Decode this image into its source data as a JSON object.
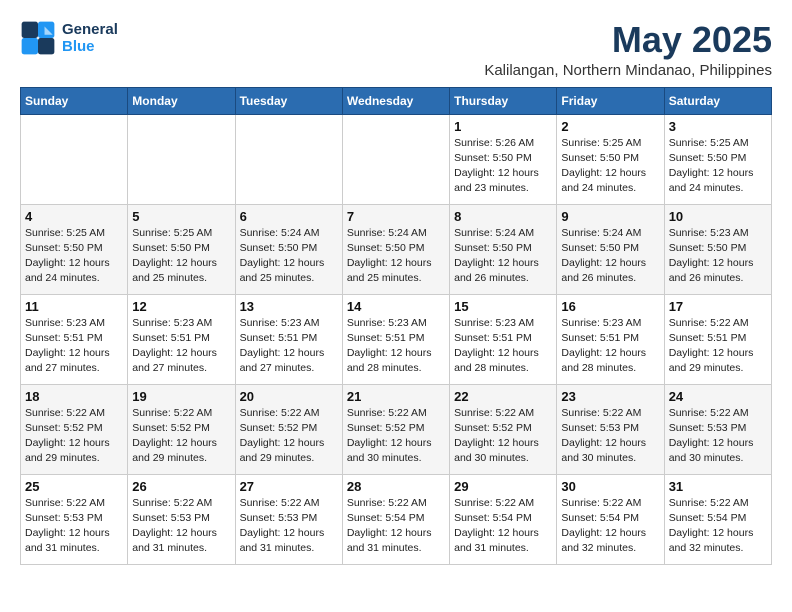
{
  "logo": {
    "text_general": "General",
    "text_blue": "Blue"
  },
  "header": {
    "title": "May 2025",
    "subtitle": "Kalilangan, Northern Mindanao, Philippines"
  },
  "weekdays": [
    "Sunday",
    "Monday",
    "Tuesday",
    "Wednesday",
    "Thursday",
    "Friday",
    "Saturday"
  ],
  "weeks": [
    [
      {
        "day": "",
        "info": ""
      },
      {
        "day": "",
        "info": ""
      },
      {
        "day": "",
        "info": ""
      },
      {
        "day": "",
        "info": ""
      },
      {
        "day": "1",
        "info": "Sunrise: 5:26 AM\nSunset: 5:50 PM\nDaylight: 12 hours\nand 23 minutes."
      },
      {
        "day": "2",
        "info": "Sunrise: 5:25 AM\nSunset: 5:50 PM\nDaylight: 12 hours\nand 24 minutes."
      },
      {
        "day": "3",
        "info": "Sunrise: 5:25 AM\nSunset: 5:50 PM\nDaylight: 12 hours\nand 24 minutes."
      }
    ],
    [
      {
        "day": "4",
        "info": "Sunrise: 5:25 AM\nSunset: 5:50 PM\nDaylight: 12 hours\nand 24 minutes."
      },
      {
        "day": "5",
        "info": "Sunrise: 5:25 AM\nSunset: 5:50 PM\nDaylight: 12 hours\nand 25 minutes."
      },
      {
        "day": "6",
        "info": "Sunrise: 5:24 AM\nSunset: 5:50 PM\nDaylight: 12 hours\nand 25 minutes."
      },
      {
        "day": "7",
        "info": "Sunrise: 5:24 AM\nSunset: 5:50 PM\nDaylight: 12 hours\nand 25 minutes."
      },
      {
        "day": "8",
        "info": "Sunrise: 5:24 AM\nSunset: 5:50 PM\nDaylight: 12 hours\nand 26 minutes."
      },
      {
        "day": "9",
        "info": "Sunrise: 5:24 AM\nSunset: 5:50 PM\nDaylight: 12 hours\nand 26 minutes."
      },
      {
        "day": "10",
        "info": "Sunrise: 5:23 AM\nSunset: 5:50 PM\nDaylight: 12 hours\nand 26 minutes."
      }
    ],
    [
      {
        "day": "11",
        "info": "Sunrise: 5:23 AM\nSunset: 5:51 PM\nDaylight: 12 hours\nand 27 minutes."
      },
      {
        "day": "12",
        "info": "Sunrise: 5:23 AM\nSunset: 5:51 PM\nDaylight: 12 hours\nand 27 minutes."
      },
      {
        "day": "13",
        "info": "Sunrise: 5:23 AM\nSunset: 5:51 PM\nDaylight: 12 hours\nand 27 minutes."
      },
      {
        "day": "14",
        "info": "Sunrise: 5:23 AM\nSunset: 5:51 PM\nDaylight: 12 hours\nand 28 minutes."
      },
      {
        "day": "15",
        "info": "Sunrise: 5:23 AM\nSunset: 5:51 PM\nDaylight: 12 hours\nand 28 minutes."
      },
      {
        "day": "16",
        "info": "Sunrise: 5:23 AM\nSunset: 5:51 PM\nDaylight: 12 hours\nand 28 minutes."
      },
      {
        "day": "17",
        "info": "Sunrise: 5:22 AM\nSunset: 5:51 PM\nDaylight: 12 hours\nand 29 minutes."
      }
    ],
    [
      {
        "day": "18",
        "info": "Sunrise: 5:22 AM\nSunset: 5:52 PM\nDaylight: 12 hours\nand 29 minutes."
      },
      {
        "day": "19",
        "info": "Sunrise: 5:22 AM\nSunset: 5:52 PM\nDaylight: 12 hours\nand 29 minutes."
      },
      {
        "day": "20",
        "info": "Sunrise: 5:22 AM\nSunset: 5:52 PM\nDaylight: 12 hours\nand 29 minutes."
      },
      {
        "day": "21",
        "info": "Sunrise: 5:22 AM\nSunset: 5:52 PM\nDaylight: 12 hours\nand 30 minutes."
      },
      {
        "day": "22",
        "info": "Sunrise: 5:22 AM\nSunset: 5:52 PM\nDaylight: 12 hours\nand 30 minutes."
      },
      {
        "day": "23",
        "info": "Sunrise: 5:22 AM\nSunset: 5:53 PM\nDaylight: 12 hours\nand 30 minutes."
      },
      {
        "day": "24",
        "info": "Sunrise: 5:22 AM\nSunset: 5:53 PM\nDaylight: 12 hours\nand 30 minutes."
      }
    ],
    [
      {
        "day": "25",
        "info": "Sunrise: 5:22 AM\nSunset: 5:53 PM\nDaylight: 12 hours\nand 31 minutes."
      },
      {
        "day": "26",
        "info": "Sunrise: 5:22 AM\nSunset: 5:53 PM\nDaylight: 12 hours\nand 31 minutes."
      },
      {
        "day": "27",
        "info": "Sunrise: 5:22 AM\nSunset: 5:53 PM\nDaylight: 12 hours\nand 31 minutes."
      },
      {
        "day": "28",
        "info": "Sunrise: 5:22 AM\nSunset: 5:54 PM\nDaylight: 12 hours\nand 31 minutes."
      },
      {
        "day": "29",
        "info": "Sunrise: 5:22 AM\nSunset: 5:54 PM\nDaylight: 12 hours\nand 31 minutes."
      },
      {
        "day": "30",
        "info": "Sunrise: 5:22 AM\nSunset: 5:54 PM\nDaylight: 12 hours\nand 32 minutes."
      },
      {
        "day": "31",
        "info": "Sunrise: 5:22 AM\nSunset: 5:54 PM\nDaylight: 12 hours\nand 32 minutes."
      }
    ]
  ]
}
